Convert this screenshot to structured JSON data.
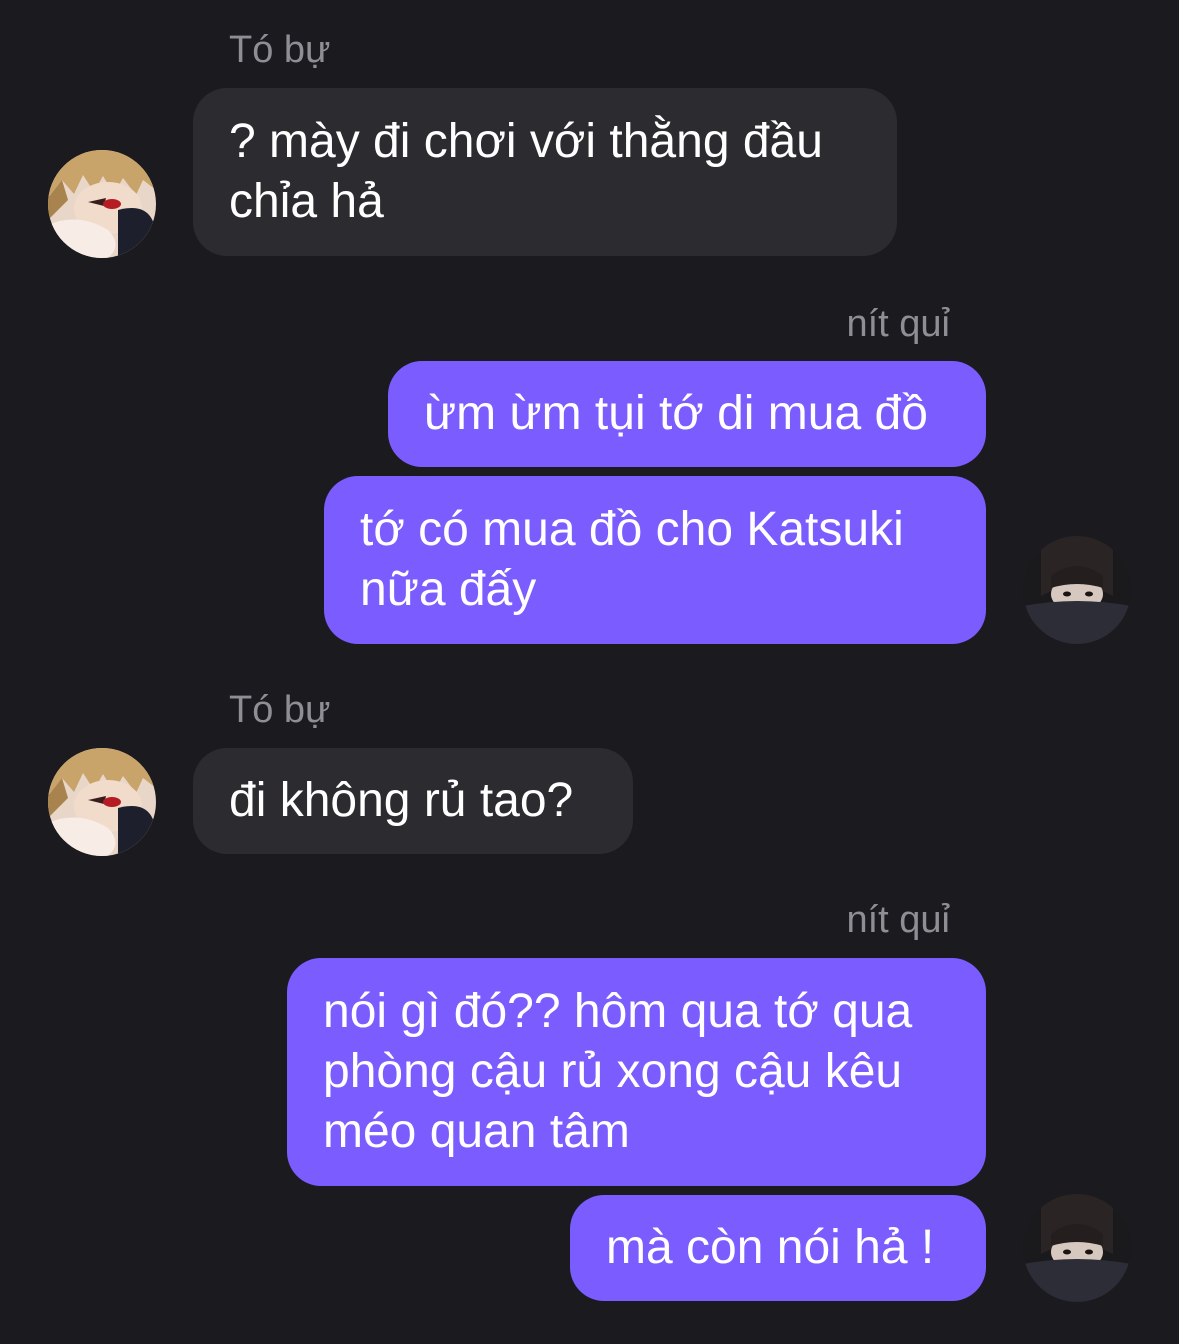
{
  "colors": {
    "background": "#1b1a1f",
    "incoming_bubble": "#2c2b30",
    "outgoing_bubble": "#7b5cff",
    "sender_name": "#8f8e95",
    "message_text": "#ffffff"
  },
  "contacts": {
    "them": {
      "name": "Tó bự",
      "avatar_icon": "anime-boy-avatar-icon"
    },
    "me": {
      "name": "nít quỉ",
      "avatar_icon": "girl-selfie-avatar-icon"
    }
  },
  "messages": [
    {
      "sender": "Tó bự",
      "text": "? mày đi chơi với thằng đầu chỉa hả"
    },
    {
      "sender": "nít quỉ",
      "text": "ừm ừm tụi tớ di mua đồ"
    },
    {
      "sender": "nít quỉ",
      "text": "tớ có mua đồ cho Katsuki nữa đấy"
    },
    {
      "sender": "Tó bự",
      "text": "đi không rủ tao?"
    },
    {
      "sender": "nít quỉ",
      "text": "nói gì đó?? hôm qua tớ qua phòng cậu rủ xong cậu kêu méo quan tâm"
    },
    {
      "sender": "nít quỉ",
      "text": "mà còn nói hả !"
    }
  ]
}
